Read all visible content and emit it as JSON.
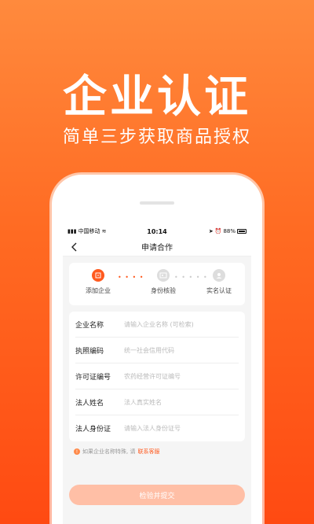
{
  "hero": {
    "title": "企业认证",
    "subtitle": "简单三步获取商品授权"
  },
  "status_bar": {
    "carrier": "中国移动",
    "time": "10:14",
    "battery": "88%"
  },
  "nav": {
    "title": "申请合作"
  },
  "steps": [
    {
      "label": "添加企业",
      "active": true
    },
    {
      "label": "身份核验",
      "active": false
    },
    {
      "label": "实名认证",
      "active": false
    }
  ],
  "form": {
    "fields": [
      {
        "label": "企业名称",
        "placeholder": "请输入企业名称 (可检索)"
      },
      {
        "label": "执照编码",
        "placeholder": "统一社会信用代码"
      },
      {
        "label": "许可证编号",
        "placeholder": "农药经营许可证编号"
      },
      {
        "label": "法人姓名",
        "placeholder": "法人真实姓名"
      },
      {
        "label": "法人身份证",
        "placeholder": "请输入法人身份证号"
      }
    ]
  },
  "tip": {
    "text": "如果企业名称特殊, 请",
    "link": "联系客服"
  },
  "submit_label": "检验并提交",
  "colors": {
    "accent": "#ff5a1f",
    "button_disabled": "#ffbfa6"
  }
}
